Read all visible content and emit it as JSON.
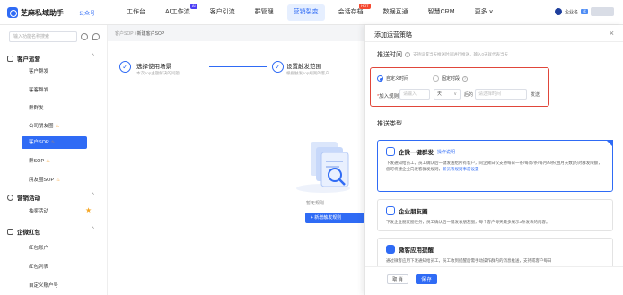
{
  "header": {
    "brand": "芝麻私域助手",
    "brand_sub": "公众号",
    "nav": [
      {
        "label": "工作台",
        "badge": ""
      },
      {
        "label": "AI工作流",
        "badge": "AI"
      },
      {
        "label": "客户引流",
        "badge": ""
      },
      {
        "label": "群管理",
        "badge": ""
      },
      {
        "label": "营销裂变",
        "badge": ""
      },
      {
        "label": "会话存档",
        "badge": "HOT"
      },
      {
        "label": "数据互通",
        "badge": ""
      },
      {
        "label": "智慧CRM",
        "badge": ""
      },
      {
        "label": "更多 ∨",
        "badge": ""
      }
    ],
    "active_nav": "营销裂变",
    "user_name": "企业名",
    "user_tag": "试"
  },
  "sidebar": {
    "search_placeholder": "输入功能名称搜索",
    "groups": [
      {
        "label": "客户运营",
        "caret": "^"
      },
      {
        "label": "营销活动",
        "caret": "^"
      },
      {
        "label": "企微红包",
        "caret": "^"
      }
    ],
    "items": [
      {
        "label": "客户群发"
      },
      {
        "label": "客客群发"
      },
      {
        "label": "群群发"
      },
      {
        "label": "公司朋友圈"
      },
      {
        "label": "客户SOP"
      },
      {
        "label": "群SOP"
      },
      {
        "label": "朋友圈SOP"
      },
      {
        "label": "抽奖活动"
      },
      {
        "label": "红包账户"
      },
      {
        "label": "红包列表"
      },
      {
        "label": "自定义账户号"
      }
    ],
    "active_item": "客户SOP"
  },
  "main": {
    "breadcrumb_parent": "客户SOP",
    "breadcrumb_sep": "/",
    "breadcrumb_current": "新建客户SOP",
    "steps": [
      {
        "title": "选择使用场景",
        "desc": "本次sop主题解决的问题",
        "icon": "check"
      },
      {
        "title": "设置触发范围",
        "desc": "根据触发sop规则的客户",
        "icon": "check"
      }
    ],
    "empty_text": "暂无规则",
    "add_rule_label": "+ 新增触发规则"
  },
  "drawer": {
    "title": "添加运营策略",
    "close": "×",
    "time_label": "推送时间",
    "time_hint": "支持设置当天推送时间进行推送，输入0天就代表当天",
    "radio_custom": "自定义时间",
    "radio_cycle": "固定时段",
    "radio_custom_checked": true,
    "join_label": "加入规则:",
    "join_required": "*",
    "day_placeholder": "请输入",
    "day_unit": "天",
    "day_select_icon": "chevron-down",
    "time_mid": "后的",
    "time_placeholder": "请选择时间",
    "send_label": "发送",
    "section_title": "推送类型",
    "types": [
      {
        "name": "企微一键群发",
        "link": "操作说明",
        "desc": "下发通知给员工，员工确认后一键发送给所有客户，同企微日仅支持每日一条/每周/条/每月/N条(由月天数)的对群发限额，您可将建企业向发客群发规则，",
        "desc_link": "新员等规则事前设置",
        "selected": true
      },
      {
        "name": "企业朋友圈",
        "link": "",
        "desc": "下发企业朋友圈任务，员工确认后一键发表朋友圈，每个客户每天最多展示3条发表的内容。",
        "desc_link": "",
        "selected": false
      },
      {
        "name": "微客应用提醒",
        "link": "",
        "desc": "通过微客应用下发通知给员工，员工收到提醒后需手动操作群内的消息推送，支持或客户每日",
        "desc_link": "",
        "selected": false
      }
    ],
    "cancel_label": "取 消",
    "save_label": "保 存"
  },
  "colors": {
    "accent": "#2f6bf5",
    "highlight_border": "#e0463a"
  }
}
